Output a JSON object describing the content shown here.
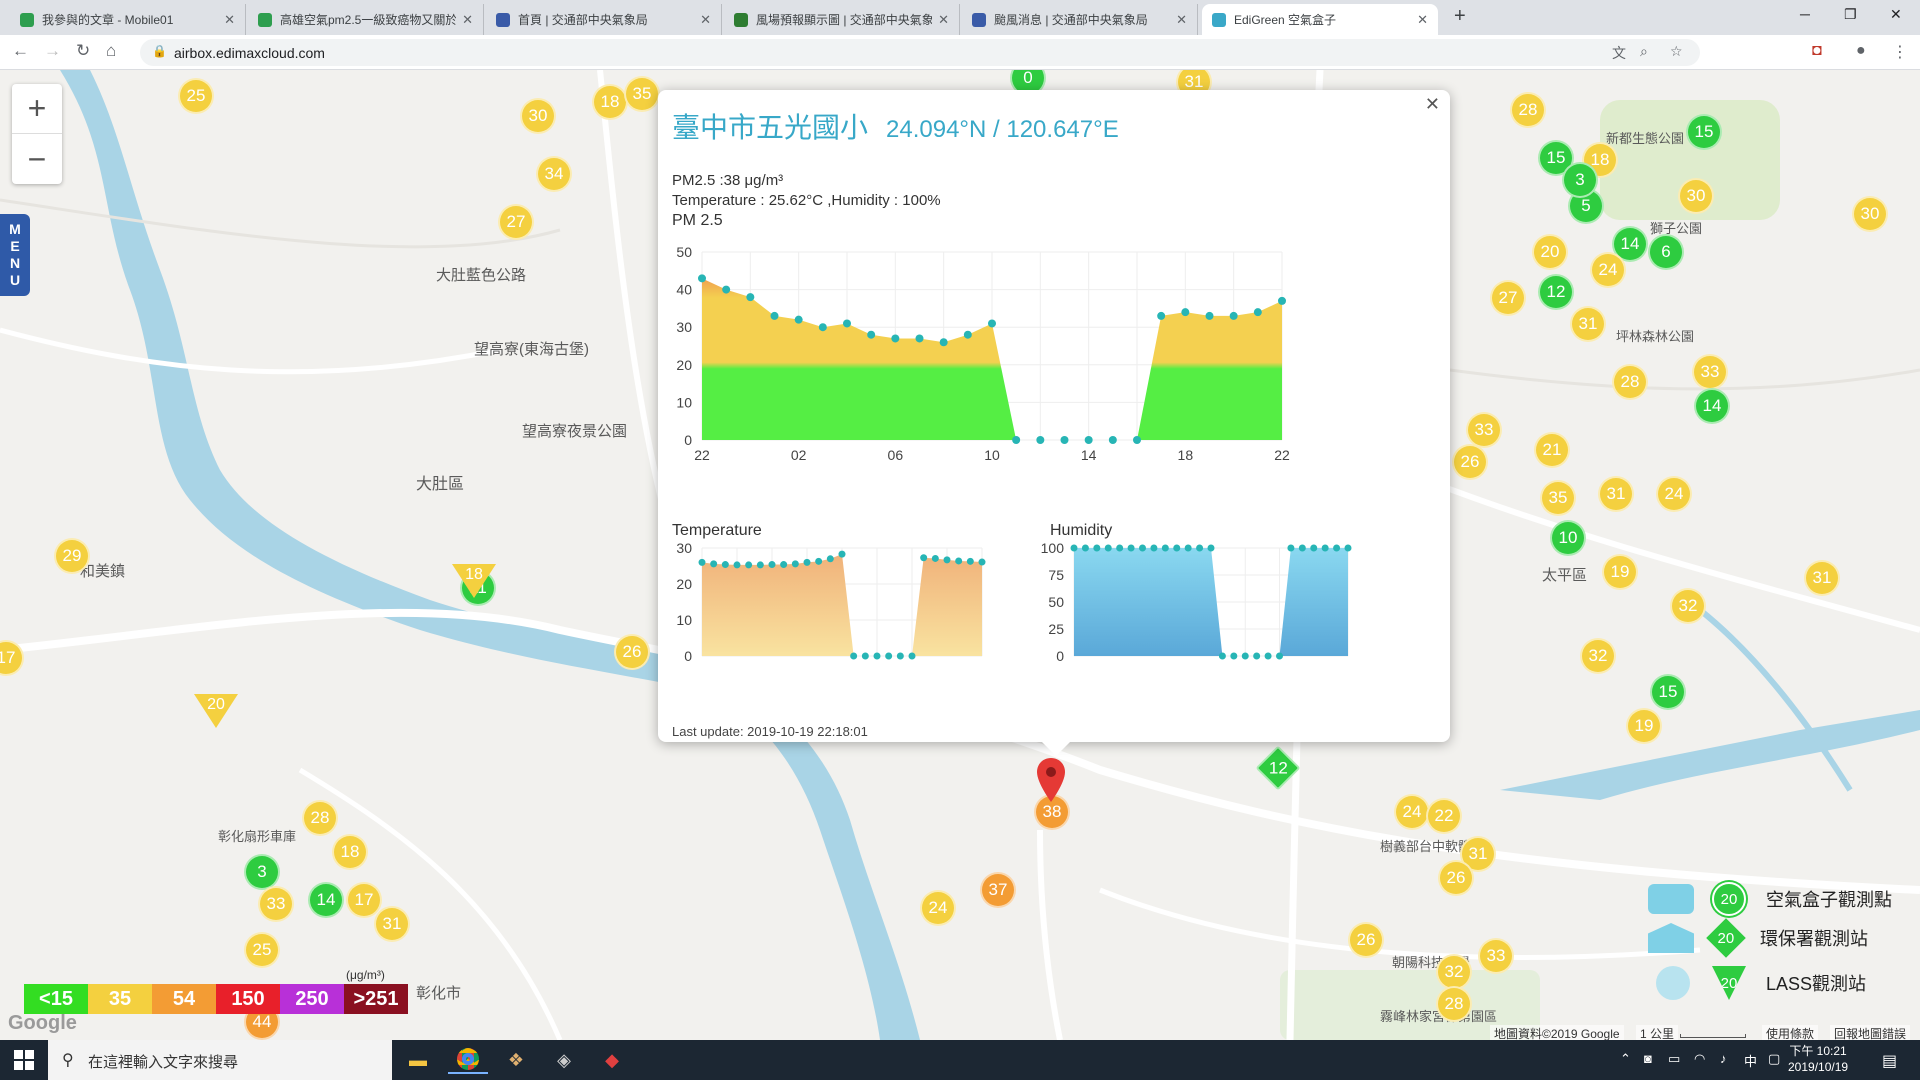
{
  "browser": {
    "tabs": [
      {
        "title": "我參與的文章 - Mobile01",
        "color": "#2e9e4f"
      },
      {
        "title": "高雄空氣pm2.5一級致癌物又關於",
        "color": "#2e9e4f"
      },
      {
        "title": "首頁 | 交通部中央氣象局",
        "color": "#3a5ba8"
      },
      {
        "title": "風場預報顯示圖 | 交通部中央氣象",
        "color": "#2e7d32"
      },
      {
        "title": "颱風消息 | 交通部中央氣象局",
        "color": "#3a5ba8"
      },
      {
        "title": "EdiGreen 空氣盒子",
        "color": "#3aa8c8"
      }
    ],
    "url": "airbox.edimaxcloud.com"
  },
  "map": {
    "labels": [
      {
        "text": "大肚藍色公路"
      },
      {
        "text": "望高寮(東海古堡)"
      },
      {
        "text": "望高寮夜景公園"
      },
      {
        "text": "大肚區"
      },
      {
        "text": "和美鎮"
      },
      {
        "text": "彰化市"
      },
      {
        "text": "太平區"
      },
      {
        "text": "坪林森林公園"
      },
      {
        "text": "新都生態公園"
      },
      {
        "text": "獅子公園"
      },
      {
        "text": "彰化扇形車庫"
      },
      {
        "text": "樹義部台中軟體園"
      },
      {
        "text": "朝陽科技大學"
      },
      {
        "text": "霧峰林家宮保第園區"
      }
    ],
    "markers": [
      {
        "v": "25",
        "t": "y"
      },
      {
        "v": "30",
        "t": "y"
      },
      {
        "v": "18",
        "t": "y"
      },
      {
        "v": "35",
        "t": "y"
      },
      {
        "v": "34",
        "t": "y"
      },
      {
        "v": "27",
        "t": "y"
      },
      {
        "v": "29",
        "t": "y"
      },
      {
        "v": "26",
        "t": "y"
      },
      {
        "v": "28",
        "t": "y"
      },
      {
        "v": "18",
        "t": "y"
      },
      {
        "v": "3",
        "t": "g"
      },
      {
        "v": "33",
        "t": "y"
      },
      {
        "v": "14",
        "t": "g"
      },
      {
        "v": "17",
        "t": "y"
      },
      {
        "v": "31",
        "t": "y"
      },
      {
        "v": "25",
        "t": "y"
      },
      {
        "v": "24",
        "t": "y"
      },
      {
        "v": "37",
        "t": "o"
      },
      {
        "v": "38",
        "t": "o"
      },
      {
        "v": "11",
        "t": "g"
      },
      {
        "v": "28",
        "t": "y"
      },
      {
        "v": "15",
        "t": "g"
      },
      {
        "v": "18",
        "t": "y"
      },
      {
        "v": "15",
        "t": "g"
      },
      {
        "v": "30",
        "t": "y"
      },
      {
        "v": "30",
        "t": "y"
      },
      {
        "v": "20",
        "t": "y"
      },
      {
        "v": "14",
        "t": "g"
      },
      {
        "v": "6",
        "t": "g"
      },
      {
        "v": "24",
        "t": "y"
      },
      {
        "v": "12",
        "t": "g"
      },
      {
        "v": "27",
        "t": "y"
      },
      {
        "v": "31",
        "t": "y"
      },
      {
        "v": "28",
        "t": "y"
      },
      {
        "v": "33",
        "t": "y"
      },
      {
        "v": "14",
        "t": "g"
      },
      {
        "v": "33",
        "t": "y"
      },
      {
        "v": "21",
        "t": "y"
      },
      {
        "v": "26",
        "t": "y"
      },
      {
        "v": "35",
        "t": "y"
      },
      {
        "v": "31",
        "t": "y"
      },
      {
        "v": "24",
        "t": "y"
      },
      {
        "v": "10",
        "t": "g"
      },
      {
        "v": "19",
        "t": "y"
      },
      {
        "v": "32",
        "t": "y"
      },
      {
        "v": "31",
        "t": "y"
      },
      {
        "v": "32",
        "t": "y"
      },
      {
        "v": "15",
        "t": "g"
      },
      {
        "v": "19",
        "t": "y"
      },
      {
        "v": "24",
        "t": "y"
      },
      {
        "v": "22",
        "t": "y"
      },
      {
        "v": "31",
        "t": "y"
      },
      {
        "v": "26",
        "t": "y"
      },
      {
        "v": "26",
        "t": "y"
      },
      {
        "v": "33",
        "t": "y"
      },
      {
        "v": "32",
        "t": "y"
      },
      {
        "v": "28",
        "t": "y"
      },
      {
        "v": "17",
        "t": "y"
      },
      {
        "v": "0",
        "t": "g"
      },
      {
        "v": "31",
        "t": "y"
      },
      {
        "v": "44",
        "t": "o"
      },
      {
        "v": "5",
        "t": "g"
      },
      {
        "v": "3",
        "t": "g"
      }
    ],
    "triangles": [
      {
        "v": "18"
      },
      {
        "v": "20"
      }
    ],
    "diamonds": [
      {
        "v": "12"
      }
    ],
    "menu_label": "MENU"
  },
  "popup": {
    "site": "臺中市五光國小",
    "coords": "24.094°N / 120.647°E",
    "pm25_line": "PM2.5 :38 μg/m³",
    "temp_line": "Temperature : 25.62°C ,Humidity : 100%",
    "pm_chart_label": "PM 2.5",
    "temp_chart_label": "Temperature",
    "hum_chart_label": "Humidity",
    "last_update": "Last update: 2019-10-19 22:18:01"
  },
  "chart_data": [
    {
      "type": "area",
      "title": "PM 2.5",
      "x_ticks": [
        "22",
        "02",
        "06",
        "10",
        "14",
        "18",
        "22"
      ],
      "ylim": [
        0,
        50
      ],
      "y_ticks": [
        0,
        10,
        20,
        30,
        40,
        50
      ],
      "values": [
        43,
        40,
        38,
        33,
        32,
        30,
        31,
        28,
        27,
        27,
        26,
        28,
        31,
        0,
        0,
        0,
        0,
        0,
        0,
        33,
        34,
        33,
        33,
        34,
        37
      ],
      "threshold_colors": {
        "green_below": 22,
        "green": "#55ee44",
        "yellow": "#f4d050",
        "orange": "#f0a050"
      }
    },
    {
      "type": "area",
      "title": "Temperature",
      "ylim": [
        0,
        30
      ],
      "y_ticks": [
        0,
        10,
        20,
        30
      ],
      "values": [
        26,
        25.6,
        25.4,
        25.3,
        25.3,
        25.3,
        25.4,
        25.4,
        25.6,
        26,
        26.3,
        27,
        28.3,
        0,
        0,
        0,
        0,
        0,
        0,
        27.3,
        27.1,
        26.7,
        26.4,
        26.3,
        26.1
      ]
    },
    {
      "type": "area",
      "title": "Humidity",
      "ylim": [
        0,
        100
      ],
      "y_ticks": [
        0,
        25,
        50,
        75,
        100
      ],
      "values": [
        100,
        100,
        100,
        100,
        100,
        100,
        100,
        100,
        100,
        100,
        100,
        100,
        100,
        0,
        0,
        0,
        0,
        0,
        0,
        100,
        100,
        100,
        100,
        100,
        100
      ]
    }
  ],
  "aqi_legend": {
    "items": [
      {
        "label": "<15",
        "color": "#33dd22"
      },
      {
        "label": "35",
        "color": "#f4d03f"
      },
      {
        "label": "54",
        "color": "#f39c34"
      },
      {
        "label": "150",
        "color": "#e8202a"
      },
      {
        "label": "250",
        "color": "#b830d8"
      },
      {
        "label": ">251",
        "color": "#8a1020"
      }
    ],
    "unit": "(μg/m³)"
  },
  "station_legend": [
    {
      "label": "空氣盒子觀測點",
      "v": "20"
    },
    {
      "label": "環保署觀測站",
      "v": "20"
    },
    {
      "label": "LASS觀測站",
      "v": "20"
    }
  ],
  "attribution": {
    "data": "地圖資料©2019 Google",
    "scale": "1 公里",
    "terms": "使用條款",
    "report": "回報地圖錯誤"
  },
  "taskbar": {
    "search_placeholder": "在這裡輸入文字來搜尋",
    "ime": "中",
    "time": "下午 10:21",
    "date": "2019/10/19"
  }
}
